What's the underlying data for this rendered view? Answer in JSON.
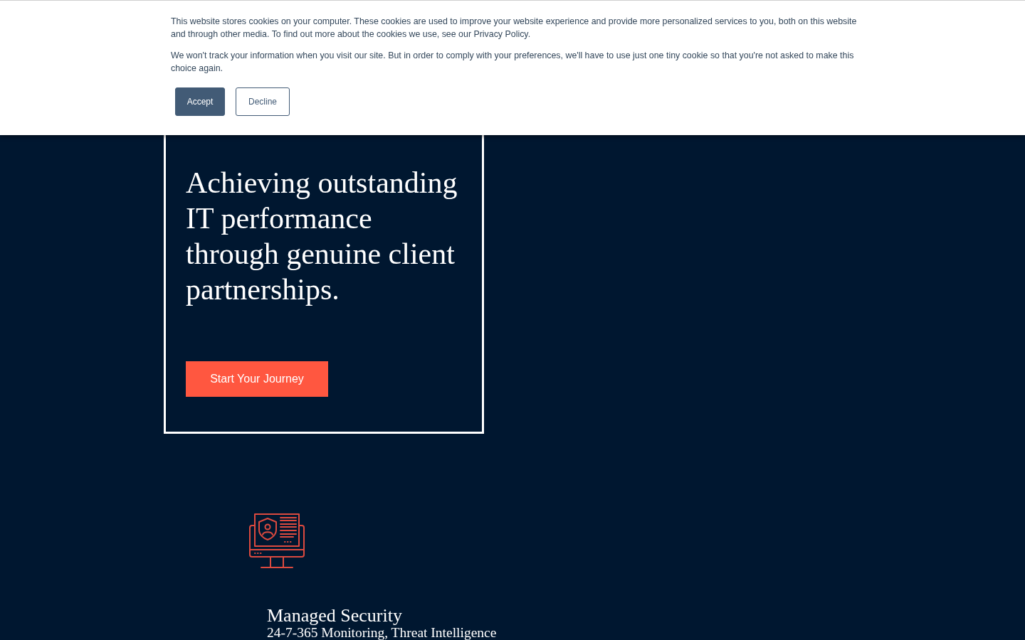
{
  "cookie_banner": {
    "paragraphs": [
      "This website stores cookies on your computer. These cookies are used to improve your website experience and provide more personalized services to you, both on this website and through other media. To find out more about the cookies we use, see our Privacy Policy.",
      "We won't track your information when you visit our site. But in order to comply with your preferences, we'll have to use just one tiny cookie so that you're not asked to make this choice again."
    ],
    "buttons": [
      {
        "label": "Accept",
        "kind": "primary"
      },
      {
        "label": "Decline",
        "kind": "secondary"
      }
    ]
  },
  "hero": {
    "heading": "Achieving outstanding IT performance through genuine client partnerships.",
    "button": "Start Your Journey"
  },
  "services": [
    {
      "title": "Managed Security",
      "subtitle": "24-7-365 Monitoring, Threat Intelligence"
    }
  ]
}
